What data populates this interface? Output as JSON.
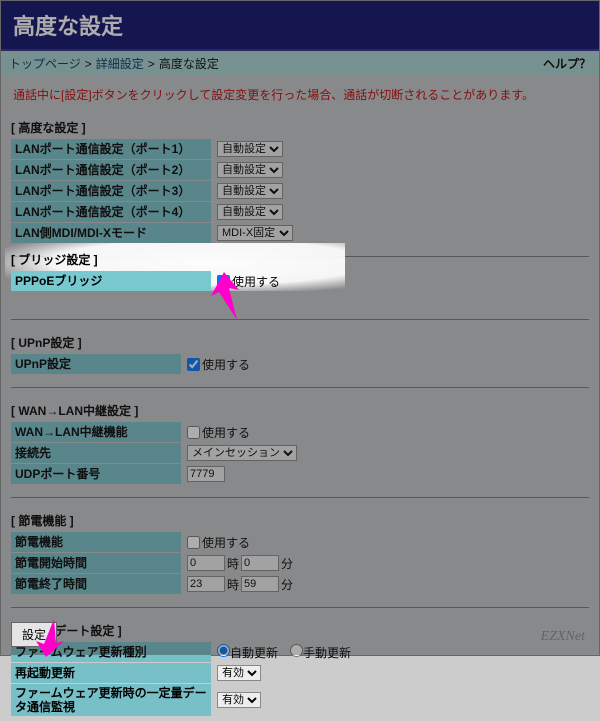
{
  "title": "高度な設定",
  "breadcrumb": {
    "top": "トップページ",
    "sep": ">",
    "detail": "詳細設定",
    "current": "高度な設定",
    "help": "ヘルプ？"
  },
  "warning": "通話中に[設定]ボタンをクリックして設定変更を行った場合、通話が切断されることがあります。",
  "advanced": {
    "heading": "[ 高度な設定 ]",
    "lan1": "LANポート通信設定（ポート1）",
    "lan2": "LANポート通信設定（ポート2）",
    "lan3": "LANポート通信設定（ポート3）",
    "lan4": "LANポート通信設定（ポート4）",
    "mdi": "LAN側MDI/MDI-Xモード",
    "opt_auto": "自動設定",
    "opt_mdi": "MDI-X固定"
  },
  "bridge": {
    "heading": "[ ブリッジ設定 ]",
    "pppoe": "PPPoEブリッジ",
    "use": "使用する"
  },
  "upnp": {
    "heading": "[ UPnP設定 ]",
    "label": "UPnP設定",
    "use": "使用する"
  },
  "wanlan": {
    "heading": "[ WAN→LAN中継設定 ]",
    "relay": "WAN→LAN中継機能",
    "use": "使用する",
    "dest": "接続先",
    "dest_opt": "メインセッション",
    "udp": "UDPポート番号",
    "udp_val": "7779"
  },
  "power": {
    "heading": "[ 節電機能 ]",
    "func": "節電機能",
    "use": "使用する",
    "start": "節電開始時間",
    "end": "節電終了時間",
    "h": "時",
    "m": "分",
    "s_h": "0",
    "s_m": "0",
    "e_h": "23",
    "e_m": "59"
  },
  "update": {
    "heading": "[ アップデート設定 ]",
    "fw_type": "ファームウェア更新種別",
    "auto": "自動更新",
    "manual": "手動更新",
    "reboot": "再起動更新",
    "reboot_opt": "有効",
    "monitor": "ファームウェア更新時の一定量データ通信監視",
    "monitor_opt": "有効"
  },
  "submit": "設定",
  "watermark": "EZXNet"
}
